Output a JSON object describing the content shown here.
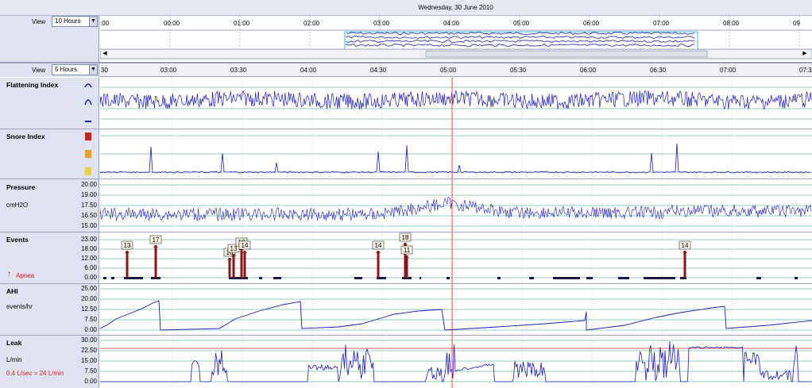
{
  "date_title": "Wednesday, 30 June 2010",
  "overview": {
    "view_label": "View",
    "view_value": "10 Hours",
    "time_ticks": [
      "00:00",
      "01:00",
      "02:00",
      "03:00",
      "04:00",
      "05:00",
      "06:00",
      "07:00",
      "08:00",
      "09"
    ],
    "left_tick": ":00"
  },
  "detail": {
    "view_label": "View",
    "view_value": "5 Hours",
    "time_ticks": [
      "03:00",
      "03:30",
      "04:00",
      "04:30",
      "05:00",
      "05:30",
      "06:00",
      "06:30",
      "07:00"
    ],
    "left_tick": "30",
    "right_tick": "07:3"
  },
  "panels": {
    "flattening": {
      "title": "Flattening Index"
    },
    "snore": {
      "title": "Snore Index"
    },
    "pressure": {
      "title": "Pressure",
      "unit": "cmH2O",
      "ticks": [
        "20.00",
        "19.00",
        "17.50",
        "16.50",
        "15.00"
      ]
    },
    "events": {
      "title": "Events",
      "legend": "Apnea",
      "ticks": [
        "23.00",
        "18.00",
        "12.00",
        "6.00",
        "0.00"
      ],
      "labels": [
        "13",
        "17",
        "16",
        "13",
        "13",
        "14",
        "14",
        "18",
        "11",
        "14"
      ]
    },
    "ahi": {
      "title": "AHI",
      "unit": "events/hr",
      "ticks": [
        "25.00",
        "20.00",
        "12.50",
        "7.50",
        "0.00"
      ]
    },
    "leak": {
      "title": "Leak",
      "unit": "L/min",
      "note": "0.4 L/sec = 24 L/min",
      "ticks": [
        "30.00",
        "22.50",
        "15.00",
        "7.50",
        "0.00"
      ]
    }
  },
  "colors": {
    "trace": "#1a1ab4",
    "grid": "#2a9a8a",
    "cursor": "#e02020",
    "event": "#8a1414",
    "legend_red": "#cc2020"
  },
  "icons": [
    "chevron-up-icon",
    "chevron-mid-icon",
    "chevron-flat-icon",
    "snore-icon",
    "apnea-icon",
    "scroll-left-icon",
    "scroll-right-icon",
    "dropdown-icon"
  ]
}
